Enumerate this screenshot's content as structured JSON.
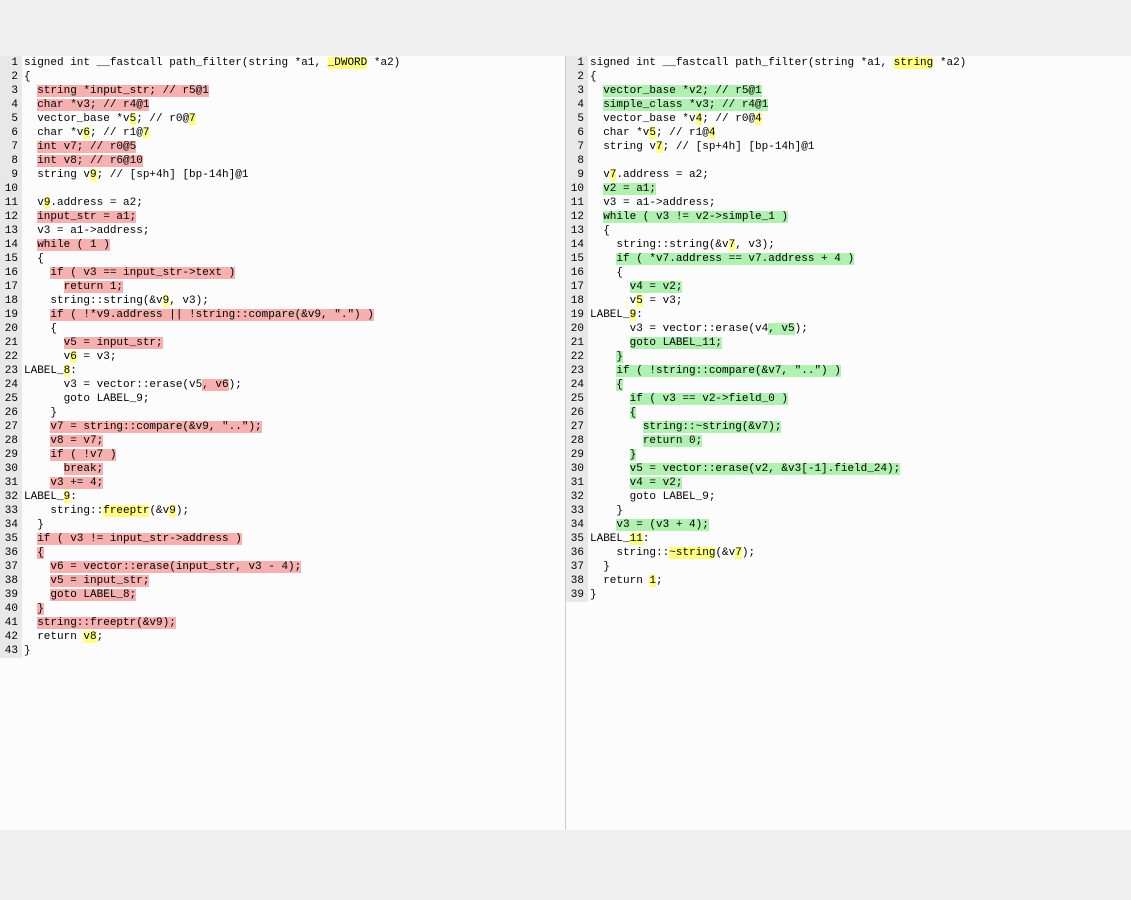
{
  "left": {
    "lines": [
      {
        "n": "1",
        "segs": [
          {
            "t": "signed int __fastcall path_filter(string *a1, "
          },
          {
            "t": "_DWORD",
            "c": "hl-yel"
          },
          {
            "t": " *a2)"
          }
        ]
      },
      {
        "n": "2",
        "segs": [
          {
            "t": "{"
          }
        ]
      },
      {
        "n": "3",
        "segs": [
          {
            "t": "  "
          },
          {
            "t": "string *input_str; // r5@1",
            "c": "hl-red"
          }
        ]
      },
      {
        "n": "4",
        "segs": [
          {
            "t": "  "
          },
          {
            "t": "char *v3; // r4@1",
            "c": "hl-red"
          }
        ]
      },
      {
        "n": "5",
        "segs": [
          {
            "t": "  vector_base *v"
          },
          {
            "t": "5",
            "c": "hl-yel"
          },
          {
            "t": "; // r0@"
          },
          {
            "t": "7",
            "c": "hl-yel"
          }
        ]
      },
      {
        "n": "6",
        "segs": [
          {
            "t": "  char *v"
          },
          {
            "t": "6",
            "c": "hl-yel"
          },
          {
            "t": "; // r1@"
          },
          {
            "t": "7",
            "c": "hl-yel"
          }
        ]
      },
      {
        "n": "7",
        "segs": [
          {
            "t": "  "
          },
          {
            "t": "int v7; // r0@5",
            "c": "hl-red"
          }
        ]
      },
      {
        "n": "8",
        "segs": [
          {
            "t": "  "
          },
          {
            "t": "int v8; // r6@10",
            "c": "hl-red"
          }
        ]
      },
      {
        "n": "9",
        "segs": [
          {
            "t": "  string v"
          },
          {
            "t": "9",
            "c": "hl-yel"
          },
          {
            "t": "; // [sp+4h] [bp-14h]@1"
          }
        ]
      },
      {
        "n": "10",
        "segs": [
          {
            "t": ""
          }
        ]
      },
      {
        "n": "11",
        "segs": [
          {
            "t": "  v"
          },
          {
            "t": "9",
            "c": "hl-yel"
          },
          {
            "t": ".address = a2;"
          }
        ]
      },
      {
        "n": "12",
        "segs": [
          {
            "t": "  "
          },
          {
            "t": "input_str = a1;",
            "c": "hl-red"
          }
        ]
      },
      {
        "n": "13",
        "segs": [
          {
            "t": "  v3 = a1->address;"
          }
        ]
      },
      {
        "n": "14",
        "segs": [
          {
            "t": "  "
          },
          {
            "t": "while ( 1 )",
            "c": "hl-red"
          }
        ]
      },
      {
        "n": "15",
        "segs": [
          {
            "t": "  {"
          }
        ]
      },
      {
        "n": "16",
        "segs": [
          {
            "t": "    "
          },
          {
            "t": "if ( v3 == input_str->text )",
            "c": "hl-red"
          }
        ]
      },
      {
        "n": "17",
        "segs": [
          {
            "t": "      "
          },
          {
            "t": "return 1;",
            "c": "hl-red"
          }
        ]
      },
      {
        "n": "18",
        "segs": [
          {
            "t": "    string::string(&v"
          },
          {
            "t": "9",
            "c": "hl-yel"
          },
          {
            "t": ", v3);"
          }
        ]
      },
      {
        "n": "19",
        "segs": [
          {
            "t": "    "
          },
          {
            "t": "if ( !*v9.address || !string::compare(&v9, \".\") )",
            "c": "hl-red"
          }
        ]
      },
      {
        "n": "20",
        "segs": [
          {
            "t": "    {"
          }
        ]
      },
      {
        "n": "21",
        "segs": [
          {
            "t": "      "
          },
          {
            "t": "v5 = input_str;",
            "c": "hl-red"
          }
        ]
      },
      {
        "n": "22",
        "segs": [
          {
            "t": "      v"
          },
          {
            "t": "6",
            "c": "hl-yel"
          },
          {
            "t": " = v3;"
          }
        ]
      },
      {
        "n": "23",
        "segs": [
          {
            "t": "LABEL_"
          },
          {
            "t": "8",
            "c": "hl-yel"
          },
          {
            "t": ":"
          }
        ]
      },
      {
        "n": "24",
        "segs": [
          {
            "t": "      v3 = vector::erase(v5"
          },
          {
            "t": ", v6",
            "c": "hl-red"
          },
          {
            "t": ");"
          }
        ]
      },
      {
        "n": "",
        "segs": [
          {
            "t": ""
          }
        ]
      },
      {
        "n": "",
        "segs": [
          {
            "t": ""
          }
        ]
      },
      {
        "n": "",
        "segs": [
          {
            "t": ""
          }
        ]
      },
      {
        "n": "",
        "segs": [
          {
            "t": ""
          }
        ]
      },
      {
        "n": "",
        "segs": [
          {
            "t": ""
          }
        ]
      },
      {
        "n": "",
        "segs": [
          {
            "t": ""
          }
        ]
      },
      {
        "n": "",
        "segs": [
          {
            "t": ""
          }
        ]
      },
      {
        "n": "",
        "segs": [
          {
            "t": ""
          }
        ]
      },
      {
        "n": "",
        "segs": [
          {
            "t": ""
          }
        ]
      },
      {
        "n": "",
        "segs": [
          {
            "t": ""
          }
        ]
      },
      {
        "n": "25",
        "segs": [
          {
            "t": "      goto LABEL_9;"
          }
        ]
      },
      {
        "n": "26",
        "segs": [
          {
            "t": "    }"
          }
        ]
      },
      {
        "n": "27",
        "segs": [
          {
            "t": "    "
          },
          {
            "t": "v7 = string::compare(&v9, \"..\");",
            "c": "hl-red"
          }
        ]
      },
      {
        "n": "28",
        "segs": [
          {
            "t": "    "
          },
          {
            "t": "v8 = v7;",
            "c": "hl-red"
          }
        ]
      },
      {
        "n": "29",
        "segs": [
          {
            "t": "    "
          },
          {
            "t": "if ( !v7 )",
            "c": "hl-red"
          }
        ]
      },
      {
        "n": "30",
        "segs": [
          {
            "t": "      "
          },
          {
            "t": "break;",
            "c": "hl-red"
          }
        ]
      },
      {
        "n": "31",
        "segs": [
          {
            "t": "    "
          },
          {
            "t": "v3 += 4;",
            "c": "hl-red"
          }
        ]
      },
      {
        "n": "32",
        "segs": [
          {
            "t": "LABEL_"
          },
          {
            "t": "9",
            "c": "hl-yel"
          },
          {
            "t": ":"
          }
        ]
      },
      {
        "n": "33",
        "segs": [
          {
            "t": "    string::"
          },
          {
            "t": "freeptr",
            "c": "hl-yel"
          },
          {
            "t": "(&v"
          },
          {
            "t": "9",
            "c": "hl-yel"
          },
          {
            "t": ");"
          }
        ]
      },
      {
        "n": "34",
        "segs": [
          {
            "t": "  }"
          }
        ]
      },
      {
        "n": "35",
        "segs": [
          {
            "t": "  "
          },
          {
            "t": "if ( v3 != input_str->address )",
            "c": "hl-red"
          }
        ]
      },
      {
        "n": "36",
        "segs": [
          {
            "t": "  "
          },
          {
            "t": "{",
            "c": "hl-red"
          }
        ]
      },
      {
        "n": "37",
        "segs": [
          {
            "t": "    "
          },
          {
            "t": "v6 = vector::erase(input_str, v3 - 4);",
            "c": "hl-red"
          }
        ]
      },
      {
        "n": "38",
        "segs": [
          {
            "t": "    "
          },
          {
            "t": "v5 = input_str;",
            "c": "hl-red"
          }
        ]
      },
      {
        "n": "39",
        "segs": [
          {
            "t": "    "
          },
          {
            "t": "goto LABEL_8;",
            "c": "hl-red"
          }
        ]
      },
      {
        "n": "40",
        "segs": [
          {
            "t": "  "
          },
          {
            "t": "}",
            "c": "hl-red"
          }
        ]
      },
      {
        "n": "41",
        "segs": [
          {
            "t": "  "
          },
          {
            "t": "string::freeptr(&v9);",
            "c": "hl-red"
          }
        ]
      },
      {
        "n": "42",
        "segs": [
          {
            "t": "  return "
          },
          {
            "t": "v8",
            "c": "hl-yel"
          },
          {
            "t": ";"
          }
        ]
      },
      {
        "n": "43",
        "segs": [
          {
            "t": "}"
          }
        ]
      }
    ]
  },
  "right": {
    "lines": [
      {
        "n": "1",
        "segs": [
          {
            "t": "signed int __fastcall path_filter(string *a1, "
          },
          {
            "t": "string",
            "c": "hl-yel"
          },
          {
            "t": " *a2)"
          }
        ]
      },
      {
        "n": "2",
        "segs": [
          {
            "t": "{"
          }
        ]
      },
      {
        "n": "3",
        "segs": [
          {
            "t": "  "
          },
          {
            "t": "vector_base *v2; // r5@1",
            "c": "hl-green"
          }
        ]
      },
      {
        "n": "4",
        "segs": [
          {
            "t": "  "
          },
          {
            "t": "simple_class *v3; // r4@1",
            "c": "hl-green"
          }
        ]
      },
      {
        "n": "5",
        "segs": [
          {
            "t": "  vector_base *v"
          },
          {
            "t": "4",
            "c": "hl-yel"
          },
          {
            "t": "; // r0@"
          },
          {
            "t": "4",
            "c": "hl-yel"
          }
        ]
      },
      {
        "n": "6",
        "segs": [
          {
            "t": "  char *v"
          },
          {
            "t": "5",
            "c": "hl-yel"
          },
          {
            "t": "; // r1@"
          },
          {
            "t": "4",
            "c": "hl-yel"
          }
        ]
      },
      {
        "n": "",
        "segs": [
          {
            "t": ""
          }
        ]
      },
      {
        "n": "",
        "segs": [
          {
            "t": ""
          }
        ]
      },
      {
        "n": "7",
        "segs": [
          {
            "t": "  string v"
          },
          {
            "t": "7",
            "c": "hl-yel"
          },
          {
            "t": "; // [sp+4h] [bp-14h]@1"
          }
        ]
      },
      {
        "n": "8",
        "segs": [
          {
            "t": ""
          }
        ]
      },
      {
        "n": "9",
        "segs": [
          {
            "t": "  v"
          },
          {
            "t": "7",
            "c": "hl-yel"
          },
          {
            "t": ".address = a2;"
          }
        ]
      },
      {
        "n": "10",
        "segs": [
          {
            "t": "  "
          },
          {
            "t": "v2 = a1;",
            "c": "hl-green"
          }
        ]
      },
      {
        "n": "11",
        "segs": [
          {
            "t": "  v3 = a1->address;"
          }
        ]
      },
      {
        "n": "12",
        "segs": [
          {
            "t": "  "
          },
          {
            "t": "while ( v3 != v2->simple_1 )",
            "c": "hl-green"
          }
        ]
      },
      {
        "n": "13",
        "segs": [
          {
            "t": "  {"
          }
        ]
      },
      {
        "n": "",
        "segs": [
          {
            "t": ""
          }
        ]
      },
      {
        "n": "",
        "segs": [
          {
            "t": ""
          }
        ]
      },
      {
        "n": "14",
        "segs": [
          {
            "t": "    string::string(&v"
          },
          {
            "t": "7",
            "c": "hl-yel"
          },
          {
            "t": ", v3);"
          }
        ]
      },
      {
        "n": "15",
        "segs": [
          {
            "t": "    "
          },
          {
            "t": "if ( *v7.address == v7.address + 4 )",
            "c": "hl-green"
          }
        ]
      },
      {
        "n": "16",
        "segs": [
          {
            "t": "    {"
          }
        ]
      },
      {
        "n": "17",
        "segs": [
          {
            "t": "      "
          },
          {
            "t": "v4 = v2;",
            "c": "hl-green"
          }
        ]
      },
      {
        "n": "18",
        "segs": [
          {
            "t": "      v"
          },
          {
            "t": "5",
            "c": "hl-yel"
          },
          {
            "t": " = v3;"
          }
        ]
      },
      {
        "n": "19",
        "segs": [
          {
            "t": "LABEL_"
          },
          {
            "t": "9",
            "c": "hl-yel"
          },
          {
            "t": ":"
          }
        ]
      },
      {
        "n": "20",
        "segs": [
          {
            "t": "      v3 = vector::erase(v4"
          },
          {
            "t": ", v5",
            "c": "hl-green"
          },
          {
            "t": ");"
          }
        ]
      },
      {
        "n": "21",
        "segs": [
          {
            "t": "      "
          },
          {
            "t": "goto LABEL_11;",
            "c": "hl-green"
          }
        ]
      },
      {
        "n": "22",
        "segs": [
          {
            "t": "    "
          },
          {
            "t": "}",
            "c": "hl-green"
          }
        ]
      },
      {
        "n": "23",
        "segs": [
          {
            "t": "    "
          },
          {
            "t": "if ( !string::compare(&v7, \"..\") )",
            "c": "hl-green"
          }
        ]
      },
      {
        "n": "24",
        "segs": [
          {
            "t": "    "
          },
          {
            "t": "{",
            "c": "hl-green"
          }
        ]
      },
      {
        "n": "25",
        "segs": [
          {
            "t": "      "
          },
          {
            "t": "if ( v3 == v2->field_0 )",
            "c": "hl-green"
          }
        ]
      },
      {
        "n": "26",
        "segs": [
          {
            "t": "      "
          },
          {
            "t": "{",
            "c": "hl-green"
          }
        ]
      },
      {
        "n": "27",
        "segs": [
          {
            "t": "        "
          },
          {
            "t": "string::~string(&v7);",
            "c": "hl-green"
          }
        ]
      },
      {
        "n": "28",
        "segs": [
          {
            "t": "        "
          },
          {
            "t": "return 0;",
            "c": "hl-green"
          }
        ]
      },
      {
        "n": "29",
        "segs": [
          {
            "t": "      "
          },
          {
            "t": "}",
            "c": "hl-green"
          }
        ]
      },
      {
        "n": "30",
        "segs": [
          {
            "t": "      "
          },
          {
            "t": "v5 = vector::erase(v2, &v3[-1].field_24);",
            "c": "hl-green"
          }
        ]
      },
      {
        "n": "31",
        "segs": [
          {
            "t": "      "
          },
          {
            "t": "v4 = v2;",
            "c": "hl-green"
          }
        ]
      },
      {
        "n": "32",
        "segs": [
          {
            "t": "      goto LABEL_9;"
          }
        ]
      },
      {
        "n": "33",
        "segs": [
          {
            "t": "    }"
          }
        ]
      },
      {
        "n": "34",
        "segs": [
          {
            "t": "    "
          },
          {
            "t": "v3 = (v3 + 4);",
            "c": "hl-green"
          }
        ]
      },
      {
        "n": "",
        "segs": [
          {
            "t": ""
          }
        ]
      },
      {
        "n": "",
        "segs": [
          {
            "t": ""
          }
        ]
      },
      {
        "n": "",
        "segs": [
          {
            "t": ""
          }
        ]
      },
      {
        "n": "",
        "segs": [
          {
            "t": ""
          }
        ]
      },
      {
        "n": "",
        "segs": [
          {
            "t": ""
          }
        ]
      },
      {
        "n": "35",
        "segs": [
          {
            "t": "LABEL_"
          },
          {
            "t": "11",
            "c": "hl-yel"
          },
          {
            "t": ":"
          }
        ]
      },
      {
        "n": "36",
        "segs": [
          {
            "t": "    string::"
          },
          {
            "t": "~string",
            "c": "hl-yel"
          },
          {
            "t": "(&v"
          },
          {
            "t": "7",
            "c": "hl-yel"
          },
          {
            "t": ");"
          }
        ]
      },
      {
        "n": "37",
        "segs": [
          {
            "t": "  }"
          }
        ]
      },
      {
        "n": "",
        "segs": [
          {
            "t": ""
          }
        ]
      },
      {
        "n": "",
        "segs": [
          {
            "t": ""
          }
        ]
      },
      {
        "n": "",
        "segs": [
          {
            "t": ""
          }
        ]
      },
      {
        "n": "",
        "segs": [
          {
            "t": ""
          }
        ]
      },
      {
        "n": "",
        "segs": [
          {
            "t": ""
          }
        ]
      },
      {
        "n": "",
        "segs": [
          {
            "t": ""
          }
        ]
      },
      {
        "n": "",
        "segs": [
          {
            "t": ""
          }
        ]
      },
      {
        "n": "38",
        "segs": [
          {
            "t": "  return "
          },
          {
            "t": "1",
            "c": "hl-yel"
          },
          {
            "t": ";"
          }
        ]
      },
      {
        "n": "39",
        "segs": [
          {
            "t": "}"
          }
        ]
      }
    ]
  }
}
